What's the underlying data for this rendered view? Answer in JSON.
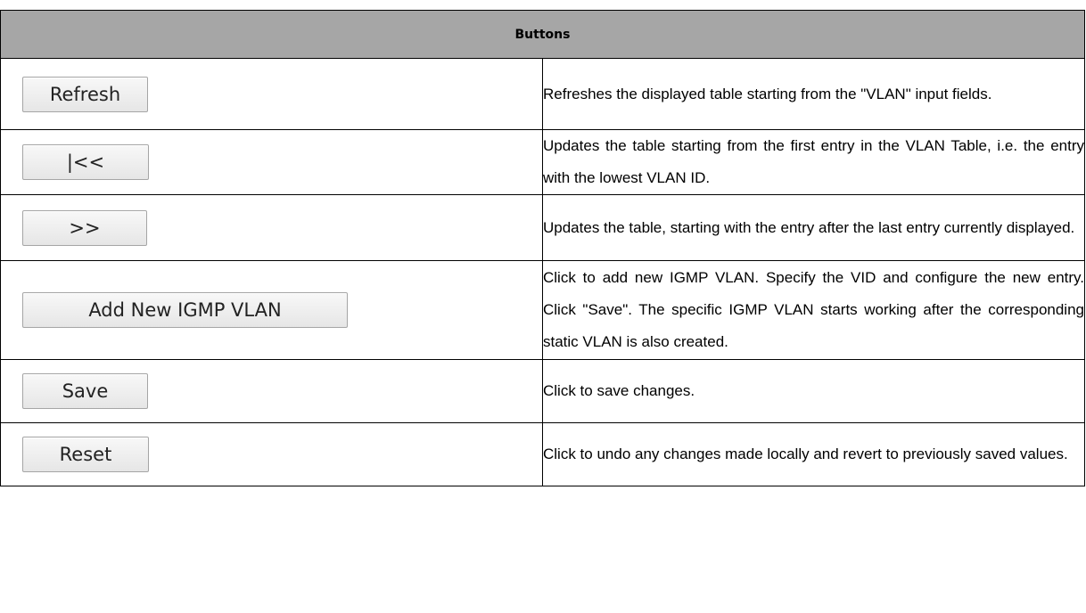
{
  "table": {
    "header": "Buttons",
    "rows": [
      {
        "button_label": "Refresh",
        "description": "Refreshes the displayed table starting from the \"VLAN\" input fields."
      },
      {
        "button_label": "|<<",
        "description": "Updates the table starting from the first entry in the VLAN Table, i.e. the entry with the lowest VLAN ID."
      },
      {
        "button_label": ">>",
        "description": "Updates the table, starting with the entry after the last entry currently displayed."
      },
      {
        "button_label": "Add New IGMP VLAN",
        "description": "Click to add new IGMP VLAN. Specify the VID and configure the new entry. Click \"Save\". The specific IGMP VLAN starts working after the corresponding static VLAN is also created."
      },
      {
        "button_label": "Save",
        "description": "Click to save changes."
      },
      {
        "button_label": "Reset",
        "description": "Click to undo any changes made locally and revert to previously saved values."
      }
    ]
  }
}
